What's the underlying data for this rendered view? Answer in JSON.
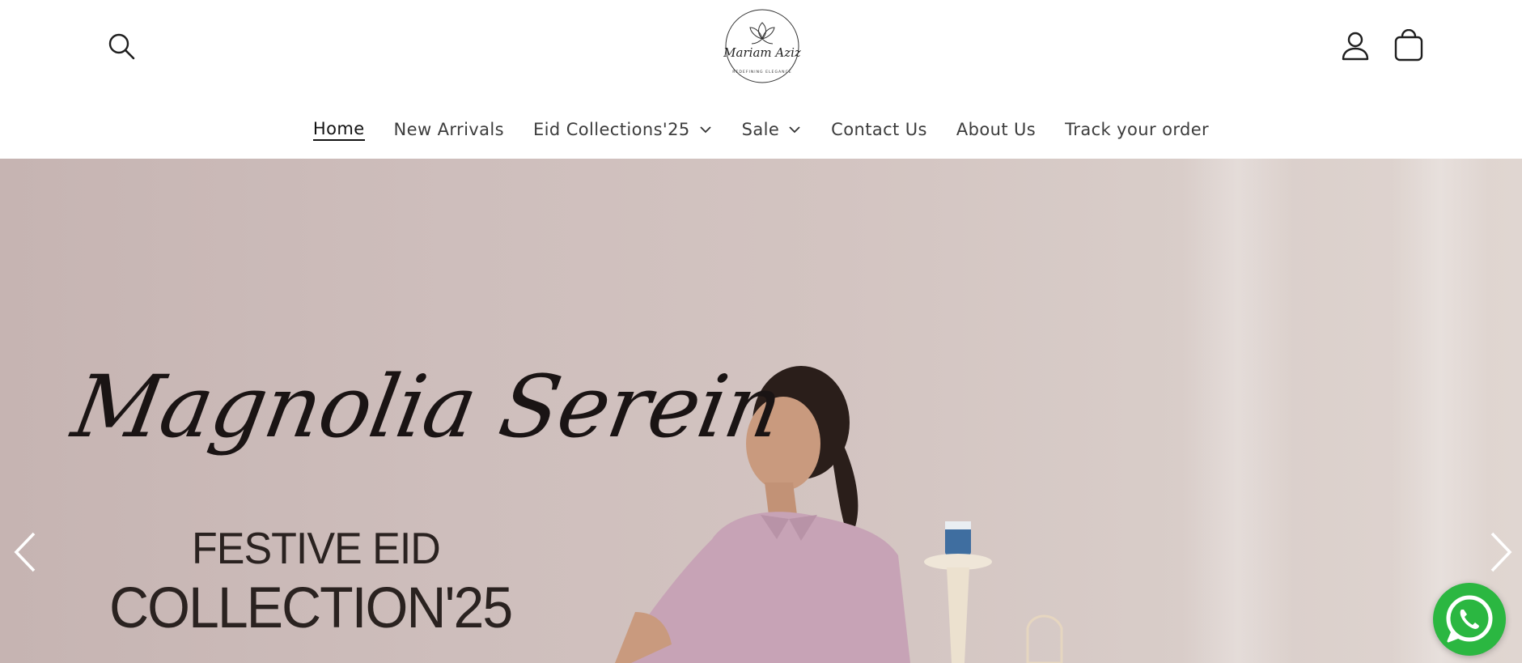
{
  "header": {
    "logo": {
      "script_text": "Mariam Aziz",
      "tagline": "REDEFINING ELEGANCE"
    },
    "icons": {
      "search": "search-icon",
      "account": "user-icon",
      "cart": "cart-icon"
    }
  },
  "nav": {
    "items": [
      {
        "label": "Home",
        "active": true,
        "has_dropdown": false
      },
      {
        "label": "New Arrivals",
        "active": false,
        "has_dropdown": false
      },
      {
        "label": "Eid Collections'25",
        "active": false,
        "has_dropdown": true
      },
      {
        "label": "Sale",
        "active": false,
        "has_dropdown": true
      },
      {
        "label": "Contact Us",
        "active": false,
        "has_dropdown": false
      },
      {
        "label": "About Us",
        "active": false,
        "has_dropdown": false
      },
      {
        "label": "Track your order",
        "active": false,
        "has_dropdown": false
      }
    ]
  },
  "hero": {
    "script_title": "Magnolia Serein",
    "line1": "FESTIVE EID",
    "line2": "COLLECTION'25",
    "prev_icon": "chevron-left-icon",
    "next_icon": "chevron-right-icon"
  },
  "whatsapp": {
    "icon": "whatsapp-icon",
    "color": "#2bb741"
  }
}
